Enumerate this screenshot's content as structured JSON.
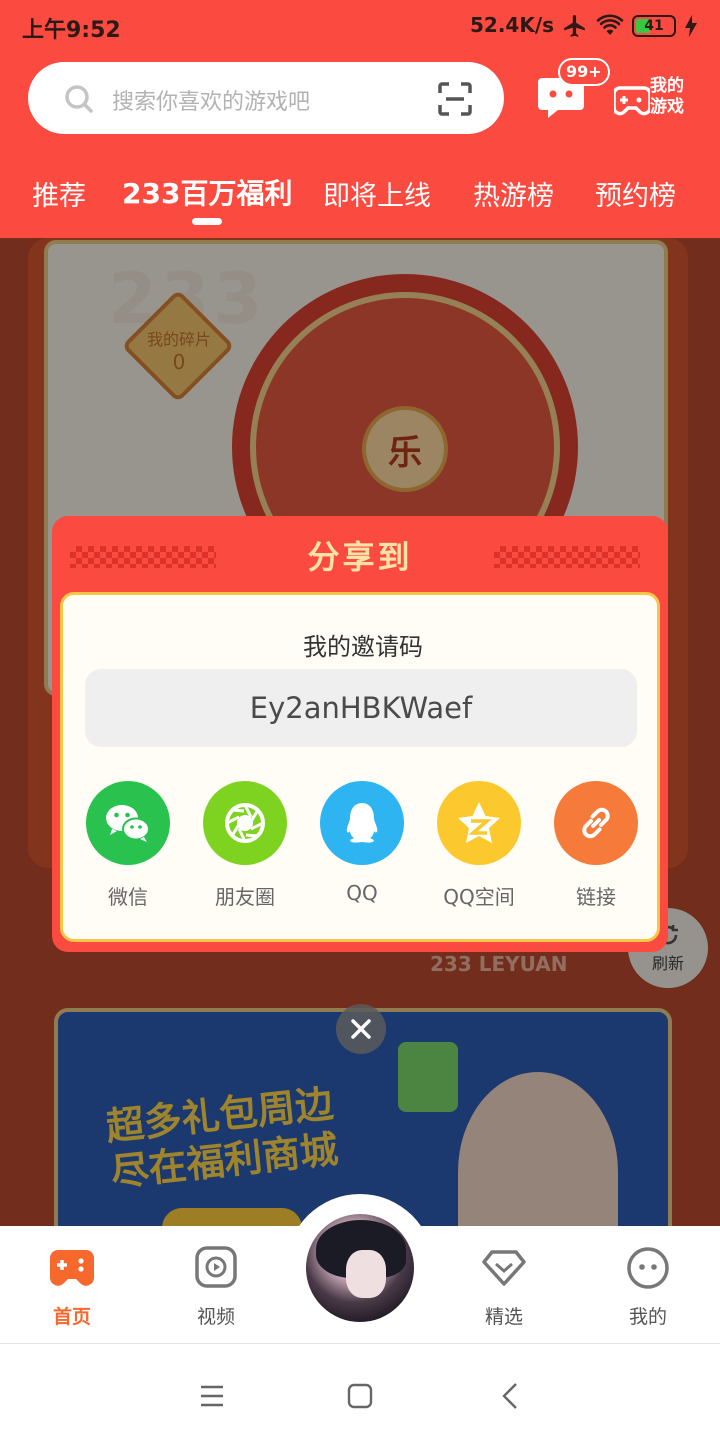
{
  "status_bar": {
    "time": "上午9:52",
    "network_speed": "52.4K/s",
    "battery_level": "41"
  },
  "search": {
    "placeholder": "搜索你喜欢的游戏吧"
  },
  "header": {
    "message_badge": "99+",
    "my_games_line1": "我的",
    "my_games_line2": "游戏"
  },
  "tabs": [
    {
      "label": "推荐",
      "active": false
    },
    {
      "label": "233百万福利",
      "active": true
    },
    {
      "label": "即将上线",
      "active": false
    },
    {
      "label": "热游榜",
      "active": false
    },
    {
      "label": "预约榜",
      "active": false
    }
  ],
  "background": {
    "fragments_label": "我的碎片",
    "fragments_count": "0",
    "wheel_center": "乐",
    "leyuan_text": "233 LEYUAN",
    "refresh_label": "刷新",
    "promo_line1": "超多礼包周边",
    "promo_line2": "尽在福利商城"
  },
  "share_dialog": {
    "title": "分享到",
    "invite_label": "我的邀请码",
    "invite_code": "Ey2anHBKWaef",
    "options": [
      {
        "label": "微信",
        "icon": "wechat-icon",
        "color": "#2ac24f"
      },
      {
        "label": "朋友圈",
        "icon": "moments-icon",
        "color": "#7ed321"
      },
      {
        "label": "QQ",
        "icon": "qq-icon",
        "color": "#2eb4f0"
      },
      {
        "label": "QQ空间",
        "icon": "qzone-icon",
        "color": "#fbc82d"
      },
      {
        "label": "链接",
        "icon": "link-icon",
        "color": "#f67a3a"
      }
    ]
  },
  "bottom_nav": [
    {
      "label": "首页",
      "icon": "gamepad-icon",
      "active": true
    },
    {
      "label": "视频",
      "icon": "video-icon",
      "active": false
    },
    {
      "label": "精选",
      "icon": "featured-icon",
      "active": false
    },
    {
      "label": "我的",
      "icon": "profile-icon",
      "active": false
    }
  ],
  "colors": {
    "brand_red": "#fb4a3f",
    "accent_orange": "#f7682d",
    "dialog_gold": "#ffe3a6"
  }
}
